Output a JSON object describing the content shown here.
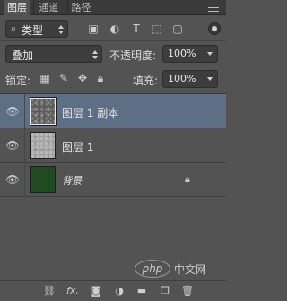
{
  "tabs": [
    {
      "label": "图层",
      "active": true
    },
    {
      "label": "通道",
      "active": false
    },
    {
      "label": "路径",
      "active": false
    }
  ],
  "filter": {
    "kind_label": "类型",
    "icons": [
      "image-filter-icon",
      "adjustment-filter-icon",
      "type-filter-icon",
      "shape-filter-icon",
      "smart-object-filter-icon",
      "filter-toggle-icon"
    ]
  },
  "blend": {
    "mode": "叠加",
    "opacity_label": "不透明度:",
    "opacity_value": "100%"
  },
  "lock": {
    "label": "锁定:",
    "icons": [
      "lock-transparent-icon",
      "lock-image-icon",
      "lock-position-icon",
      "lock-all-icon"
    ],
    "fill_label": "填充:",
    "fill_value": "100%"
  },
  "layers": [
    {
      "name": "图层 1 副本",
      "selected": true,
      "visible": true,
      "thumb": "noise-dark",
      "locked": false
    },
    {
      "name": "图层 1",
      "selected": false,
      "visible": true,
      "thumb": "noise-light",
      "locked": false
    },
    {
      "name": "背景",
      "selected": false,
      "visible": true,
      "thumb": "green",
      "locked": true
    }
  ],
  "watermark": {
    "logo": "php",
    "text": "中文网"
  },
  "colors": {
    "selected_row": "#5d6e85",
    "panel_bg": "#535353",
    "background_thumb": "#1f4a22"
  },
  "bottom_icons": [
    "link-layers-icon",
    "fx-icon",
    "add-mask-icon",
    "adjustment-layer-icon",
    "new-group-icon",
    "new-layer-icon",
    "delete-layer-icon"
  ]
}
